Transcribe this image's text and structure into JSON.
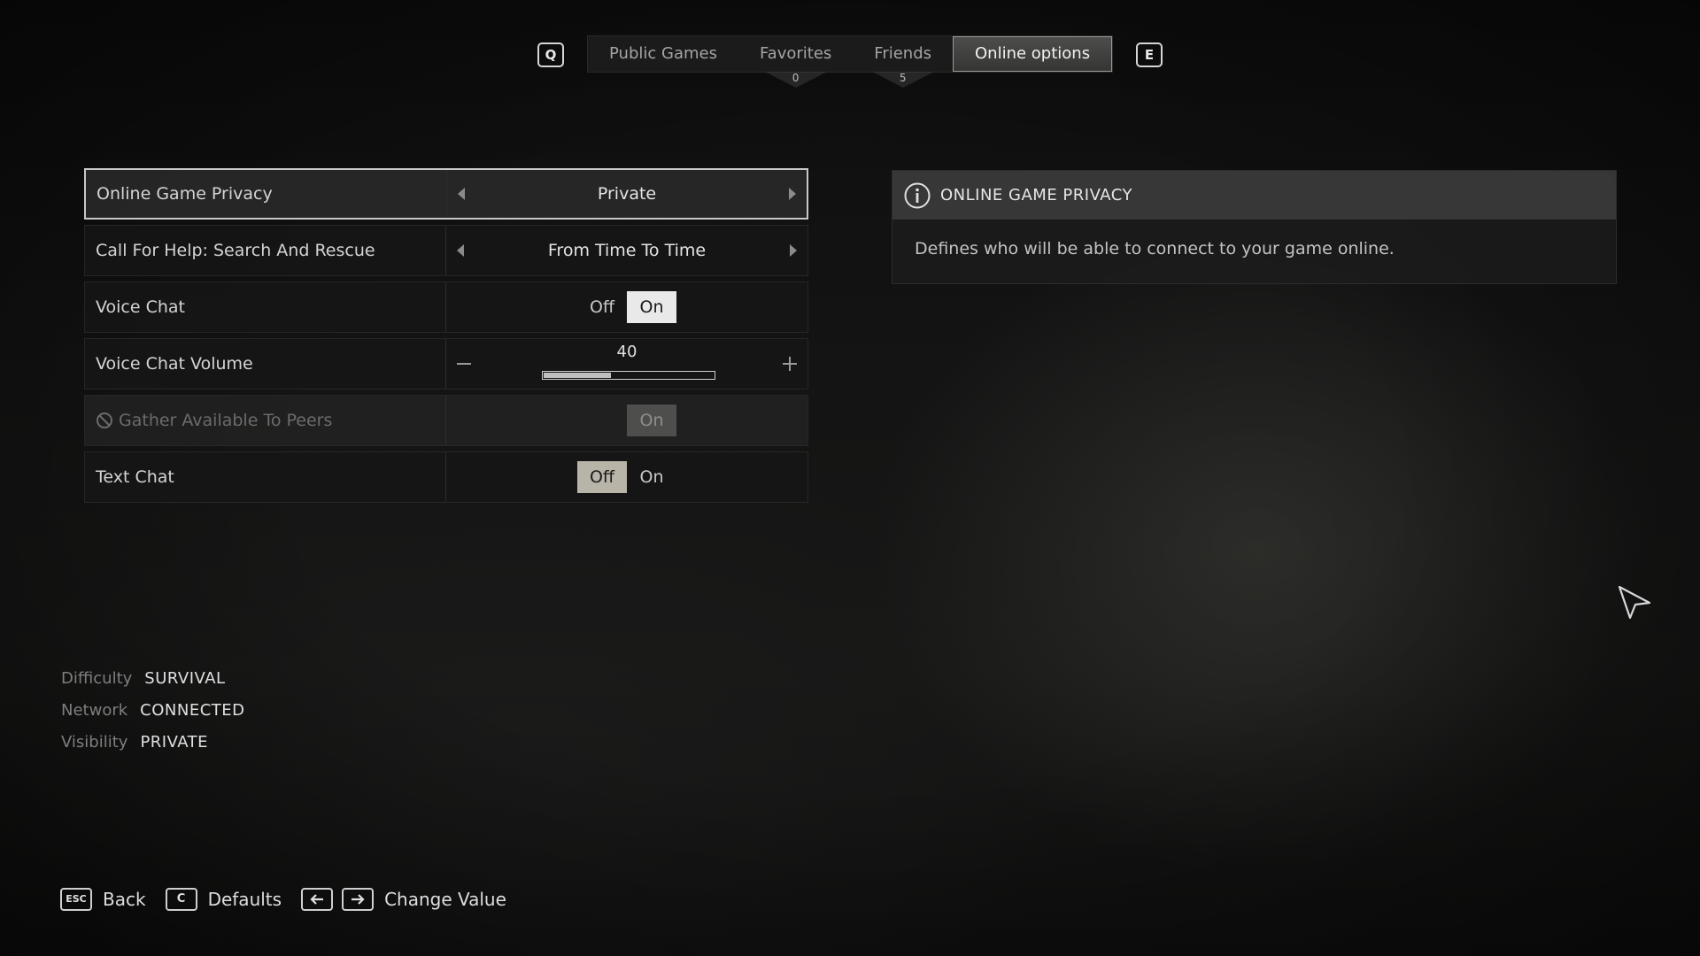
{
  "nav": {
    "prev_key": "Q",
    "next_key": "E",
    "tabs": [
      {
        "label": "Public Games",
        "active": false,
        "badge": null
      },
      {
        "label": "Favorites",
        "active": false,
        "badge": "0"
      },
      {
        "label": "Friends",
        "active": false,
        "badge": "5"
      },
      {
        "label": "Online options",
        "active": true,
        "badge": null
      }
    ]
  },
  "settings": {
    "online_game_privacy": {
      "label": "Online Game Privacy",
      "value": "Private"
    },
    "call_for_help": {
      "label": "Call For Help: Search And Rescue",
      "value": "From Time To Time"
    },
    "voice_chat": {
      "label": "Voice Chat",
      "off": "Off",
      "on": "On",
      "selected": "On"
    },
    "voice_chat_volume": {
      "label": "Voice Chat Volume",
      "value": "40",
      "fraction": 0.4
    },
    "gather_peers": {
      "label": "Gather Available To Peers",
      "on": "On",
      "disabled": true
    },
    "text_chat": {
      "label": "Text Chat",
      "off": "Off",
      "on": "On",
      "selected": "Off"
    }
  },
  "info": {
    "title": "ONLINE GAME PRIVACY",
    "description": "Defines who will be able to connect to your game online."
  },
  "status": {
    "difficulty_key": "Difficulty",
    "difficulty_val": "SURVIVAL",
    "network_key": "Network",
    "network_val": "CONNECTED",
    "visibility_key": "Visibility",
    "visibility_val": "PRIVATE"
  },
  "footer": {
    "back_key": "ESC",
    "back_label": "Back",
    "defaults_key": "C",
    "defaults_label": "Defaults",
    "change_label": "Change Value"
  },
  "icons": [
    "info-icon",
    "disabled-icon",
    "arrow-left-key-icon",
    "arrow-right-key-icon",
    "mouse-cursor-icon"
  ]
}
